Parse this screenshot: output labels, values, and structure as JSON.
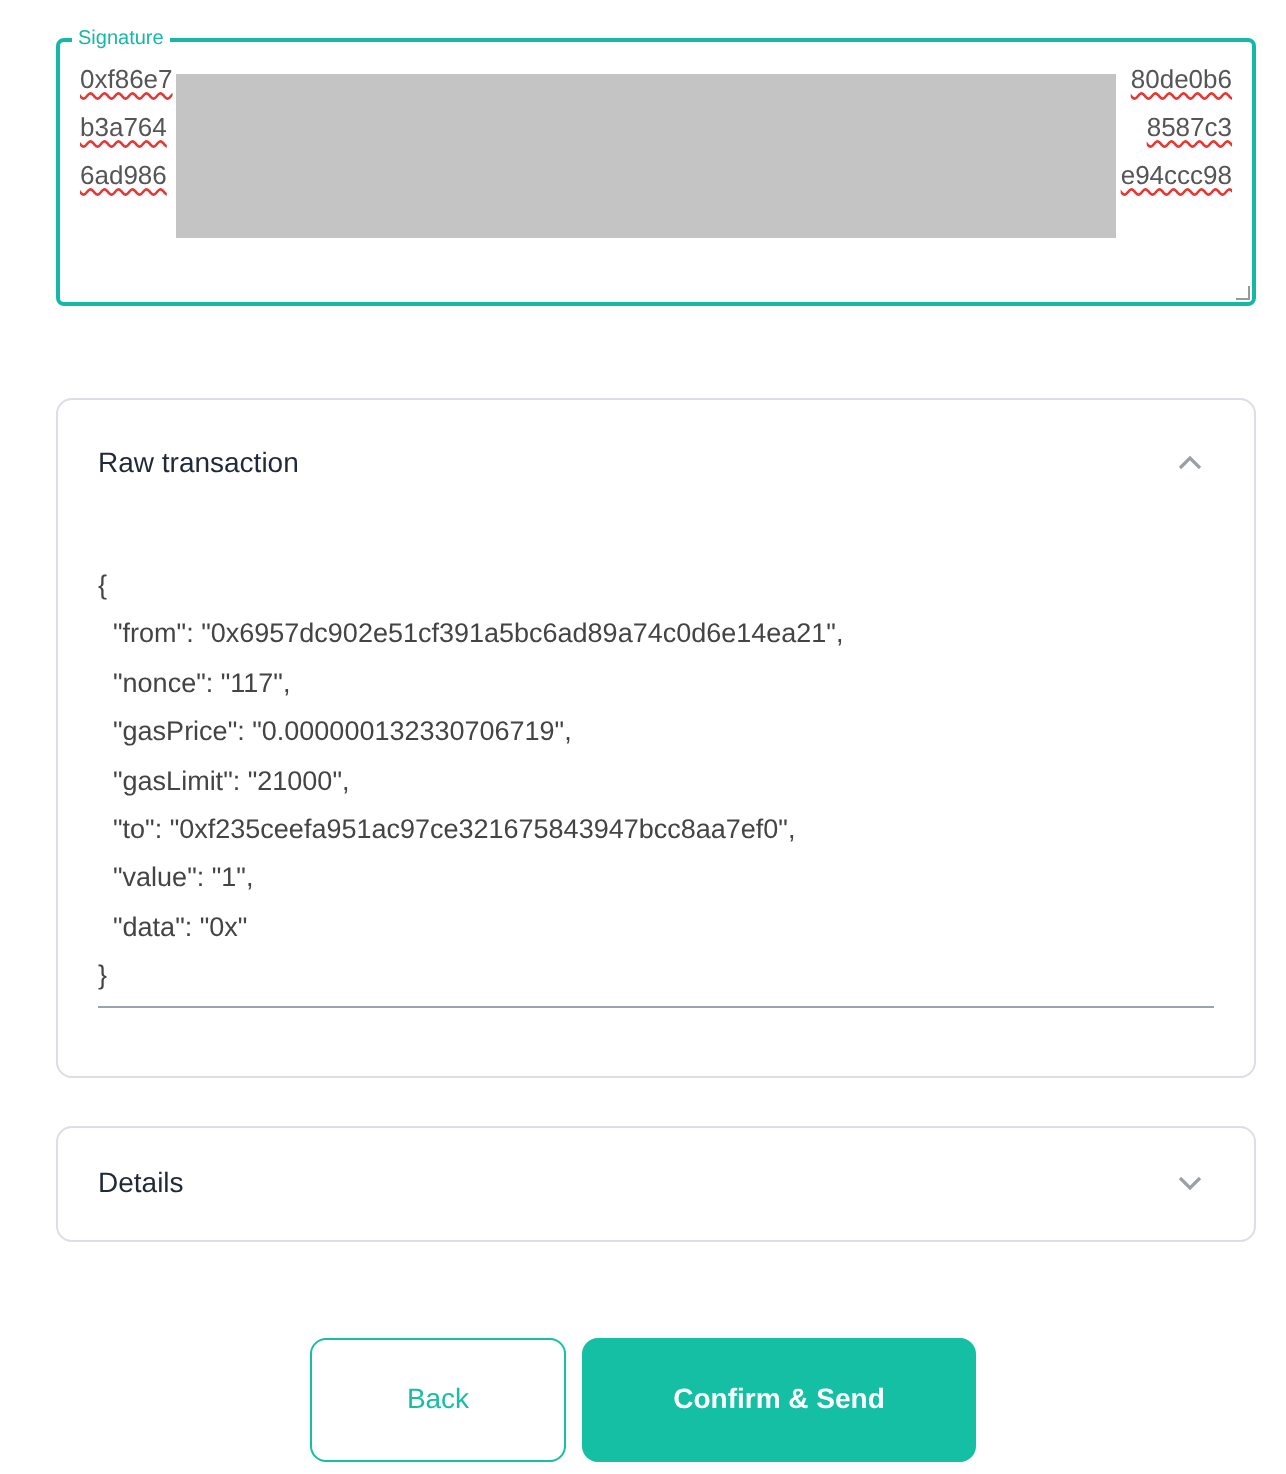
{
  "signature": {
    "label": "Signature",
    "lines": [
      {
        "start": "0xf86e7",
        "end": "80de0b6"
      },
      {
        "start": "b3a764",
        "end": "8587c3"
      },
      {
        "start": "6ad986",
        "end": "e94ccc98"
      }
    ],
    "redacted": true
  },
  "raw_transaction": {
    "title": "Raw transaction",
    "expanded": true,
    "lines": [
      "{",
      "  \"from\": \"0x6957dc902e51cf391a5bc6ad89a74c0d6e14ea21\",",
      "  \"nonce\": \"117\",",
      "  \"gasPrice\": \"0.000000132330706719\",",
      "  \"gasLimit\": \"21000\",",
      "  \"to\": \"0xf235ceefa951ac97ce321675843947bcc8aa7ef0\",",
      "  \"value\": \"1\",",
      "  \"data\": \"0x\"",
      "}"
    ]
  },
  "details": {
    "title": "Details",
    "expanded": false
  },
  "buttons": [
    {
      "label": "Back",
      "kind": "secondary"
    },
    {
      "label": "Confirm & Send",
      "kind": "primary"
    }
  ]
}
